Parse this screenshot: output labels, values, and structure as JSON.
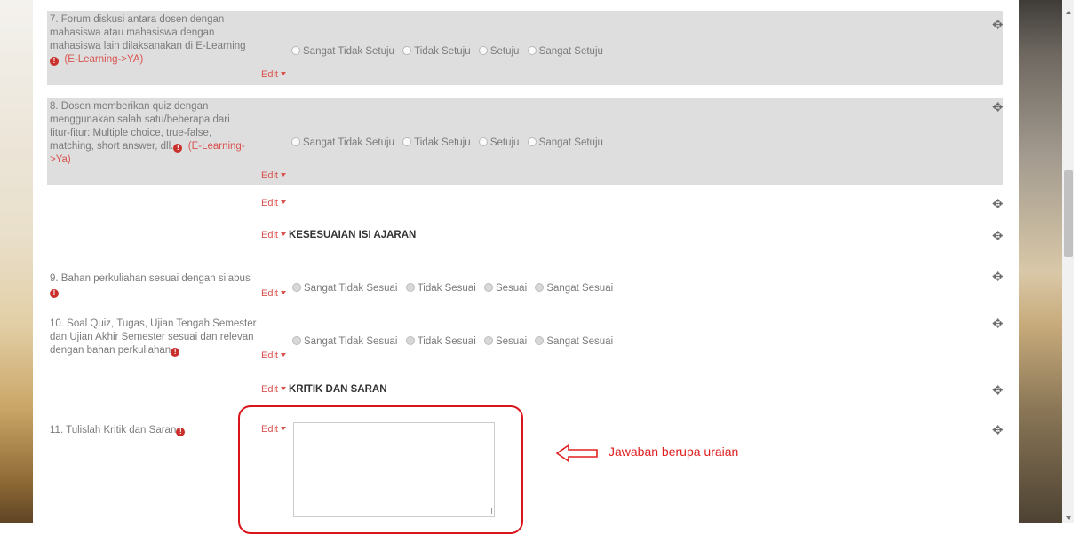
{
  "edit_label": "Edit",
  "error_mark": "!",
  "move_icon": "move-icon",
  "scale_agree": [
    "Sangat Tidak Setuju",
    "Tidak Setuju",
    "Setuju",
    "Sangat Setuju"
  ],
  "scale_fit": [
    "Sangat Tidak Sesuai",
    "Tidak Sesuai",
    "Sesuai",
    "Sangat Sesuai"
  ],
  "q7": {
    "lines": [
      "7. Forum diskusi antara dosen dengan",
      "mahasiswa atau mahasiswa dengan",
      "mahasiswa lain dilaksanakan di E-Learning"
    ],
    "tag": "(E-Learning->YA)"
  },
  "q8": {
    "lines": [
      "8. Dosen memberikan quiz dengan",
      "menggunakan salah satu/beberapa dari",
      "fitur-fitur: Multiple choice, true-false,"
    ],
    "line4": "matching, short answer, dll.",
    "tag_a": "(E-Learning-",
    "tag_b": ">Ya)"
  },
  "section_isi": "KESESUAIAN ISI AJARAN",
  "q9": {
    "line1": "9. Bahan perkuliahan sesuai dengan silabus"
  },
  "q10": {
    "lines": [
      "10. Soal Quiz, Tugas, Ujian Tengah Semester",
      "dan Ujian Akhir Semester sesuai dan relevan",
      "dengan bahan perkuliahan"
    ]
  },
  "section_kritik": "KRITIK DAN SARAN",
  "q11": {
    "label": "11. Tulislah Kritik dan Saran"
  },
  "annotation": {
    "text": "Jawaban berupa uraian",
    "color": "#e02020"
  },
  "colors": {
    "row_gray": "#dedede",
    "edit_red": "#d9534f",
    "error_red": "#c9302c"
  }
}
